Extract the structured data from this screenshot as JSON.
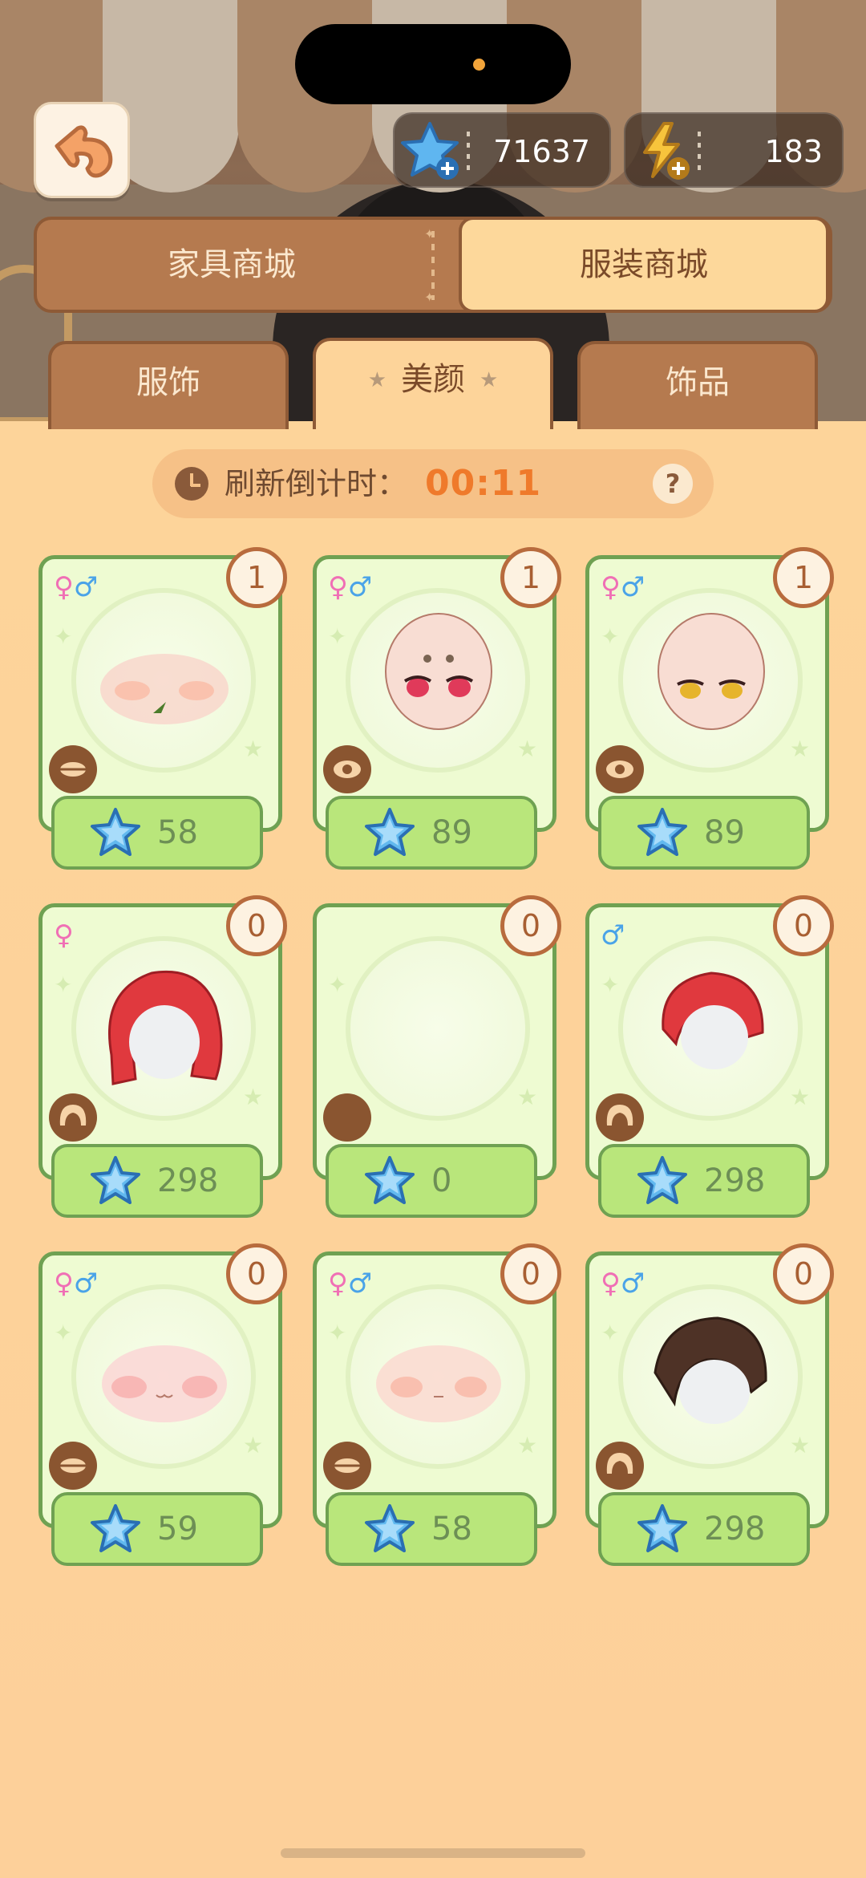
{
  "status": {
    "notch": "camera-dot"
  },
  "currency": {
    "gems": "71637",
    "energy": "183"
  },
  "main_tabs": {
    "furniture": "家具商城",
    "clothing": "服装商城"
  },
  "sub_tabs": {
    "apparel": "服饰",
    "beauty": "美颜",
    "accessories": "饰品"
  },
  "timer": {
    "label": "刷新倒计时：",
    "value": "00:11",
    "help": "?"
  },
  "items": [
    {
      "gender": [
        "♀",
        "♂"
      ],
      "count": "1",
      "price": "58",
      "category_icon": "mouth-icon",
      "art": "blush"
    },
    {
      "gender": [
        "♀",
        "♂"
      ],
      "count": "1",
      "price": "89",
      "category_icon": "eye-icon",
      "art": "face-red-eyes"
    },
    {
      "gender": [
        "♀",
        "♂"
      ],
      "count": "1",
      "price": "89",
      "category_icon": "eye-icon",
      "art": "face-yellow-eyes"
    },
    {
      "gender": [
        "♀"
      ],
      "count": "0",
      "price": "298",
      "category_icon": "hair-icon",
      "art": "red-long-hair"
    },
    {
      "gender": [],
      "count": "0",
      "price": "0",
      "category_icon": "skin-tone-icon",
      "art": "empty"
    },
    {
      "gender": [
        "♂"
      ],
      "count": "0",
      "price": "298",
      "category_icon": "hair-icon",
      "art": "red-short-hair"
    },
    {
      "gender": [
        "♀",
        "♂"
      ],
      "count": "0",
      "price": "59",
      "category_icon": "mouth-icon",
      "art": "blush-pink"
    },
    {
      "gender": [
        "♀",
        "♂"
      ],
      "count": "0",
      "price": "58",
      "category_icon": "mouth-icon",
      "art": "blush-soft"
    },
    {
      "gender": [
        "♀",
        "♂"
      ],
      "count": "0",
      "price": "298",
      "category_icon": "hair-icon",
      "art": "brown-short-hair"
    }
  ],
  "colors": {
    "accent": "#b57a4f",
    "card_border": "#6fa152",
    "timer_value": "#ef7a2b"
  }
}
